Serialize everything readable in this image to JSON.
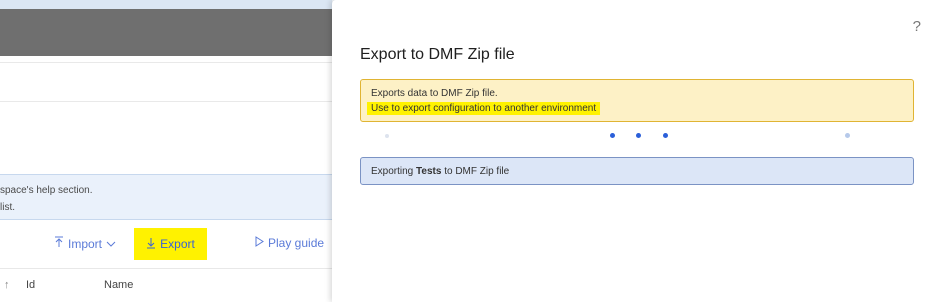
{
  "background": {
    "info_line1": "space's help section.",
    "info_line2": "list.",
    "toolbar": {
      "import_label": "Import",
      "import_icon": "arrow-up-to-line-icon",
      "export_label": "Export",
      "export_icon": "arrow-down-to-line-icon",
      "play_label": "Play guide",
      "play_icon": "play-outline-icon"
    },
    "table_headers": {
      "sort_icon": "↑",
      "id": "Id",
      "name": "Name"
    }
  },
  "panel": {
    "help": "?",
    "title": "Export to DMF Zip file",
    "message_line1": "Exports data to DMF Zip file.",
    "message_line2": "Use to export configuration to another environment",
    "status_prefix": "Exporting ",
    "status_bold": "Tests",
    "status_suffix": " to DMF Zip file"
  },
  "colors": {
    "accent": "#2b5fd9",
    "highlight": "#fff200",
    "warning_bg": "#fdf1c6",
    "info_bg": "#dce6f7"
  }
}
